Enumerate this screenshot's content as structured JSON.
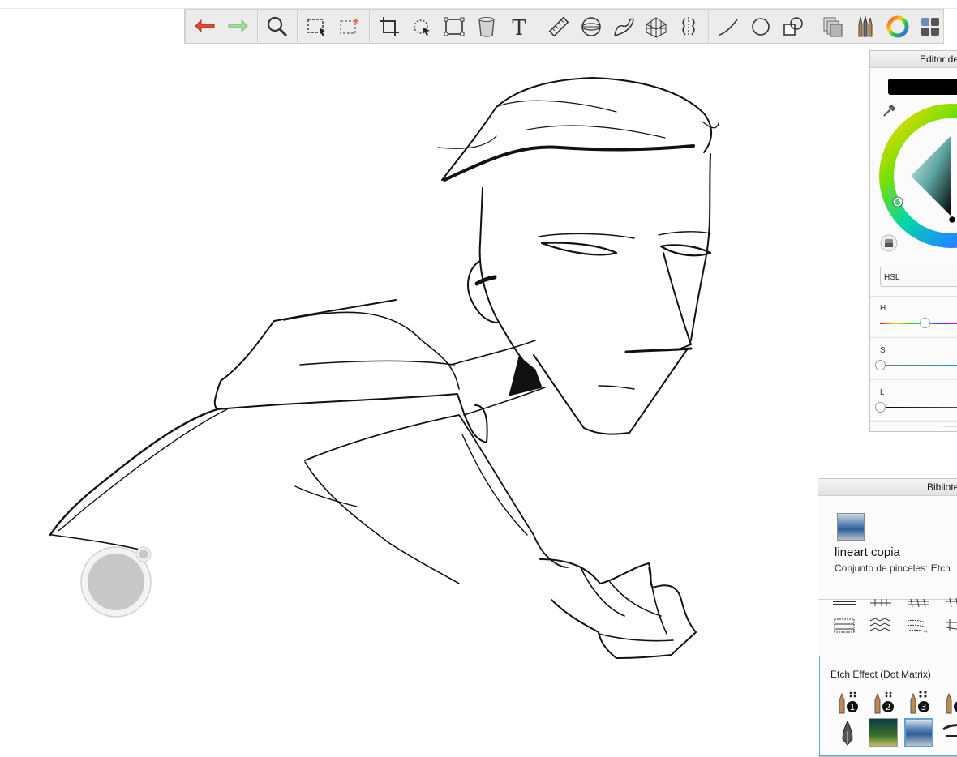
{
  "toolbar": {
    "items": [
      {
        "name": "undo-icon"
      },
      {
        "name": "redo-icon"
      },
      {
        "name": "zoom-icon"
      },
      {
        "name": "selection-icon"
      },
      {
        "name": "magic-selection-icon"
      },
      {
        "name": "crop-icon"
      },
      {
        "name": "transform-icon"
      },
      {
        "name": "distort-icon"
      },
      {
        "name": "fill-bucket-icon"
      },
      {
        "name": "text-icon"
      },
      {
        "name": "ruler-icon"
      },
      {
        "name": "ellipse-guide-icon"
      },
      {
        "name": "french-curve-icon"
      },
      {
        "name": "perspective-guide-icon"
      },
      {
        "name": "symmetry-icon"
      },
      {
        "name": "line-icon"
      },
      {
        "name": "circle-icon"
      },
      {
        "name": "shapes-icon"
      },
      {
        "name": "layers-icon"
      },
      {
        "name": "brush-library-icon"
      },
      {
        "name": "color-wheel-icon"
      },
      {
        "name": "panels-icon"
      }
    ],
    "text_glyph": "T"
  },
  "color_editor": {
    "title": "Editor de",
    "current_color": "#000000",
    "mode": "HSL",
    "h_label": "H",
    "s_label": "S",
    "l_label": "L",
    "h_value": 0.5,
    "s_value": 0.0,
    "l_value": 0.0
  },
  "brush_library": {
    "title": "Bibliote",
    "brush_name": "lineart copia",
    "brush_set": "Conjunto de pinceles: Etch",
    "set_name": "Etch Effect (Dot Matrix)",
    "dot_numbers": [
      "1",
      "2",
      "3"
    ]
  },
  "colors": {
    "toolbar_bg": "#ececec",
    "undo": "#e04b3a",
    "redo": "#8fd18f",
    "accent": "#5aa3de",
    "puck": "#c8c8c8"
  }
}
